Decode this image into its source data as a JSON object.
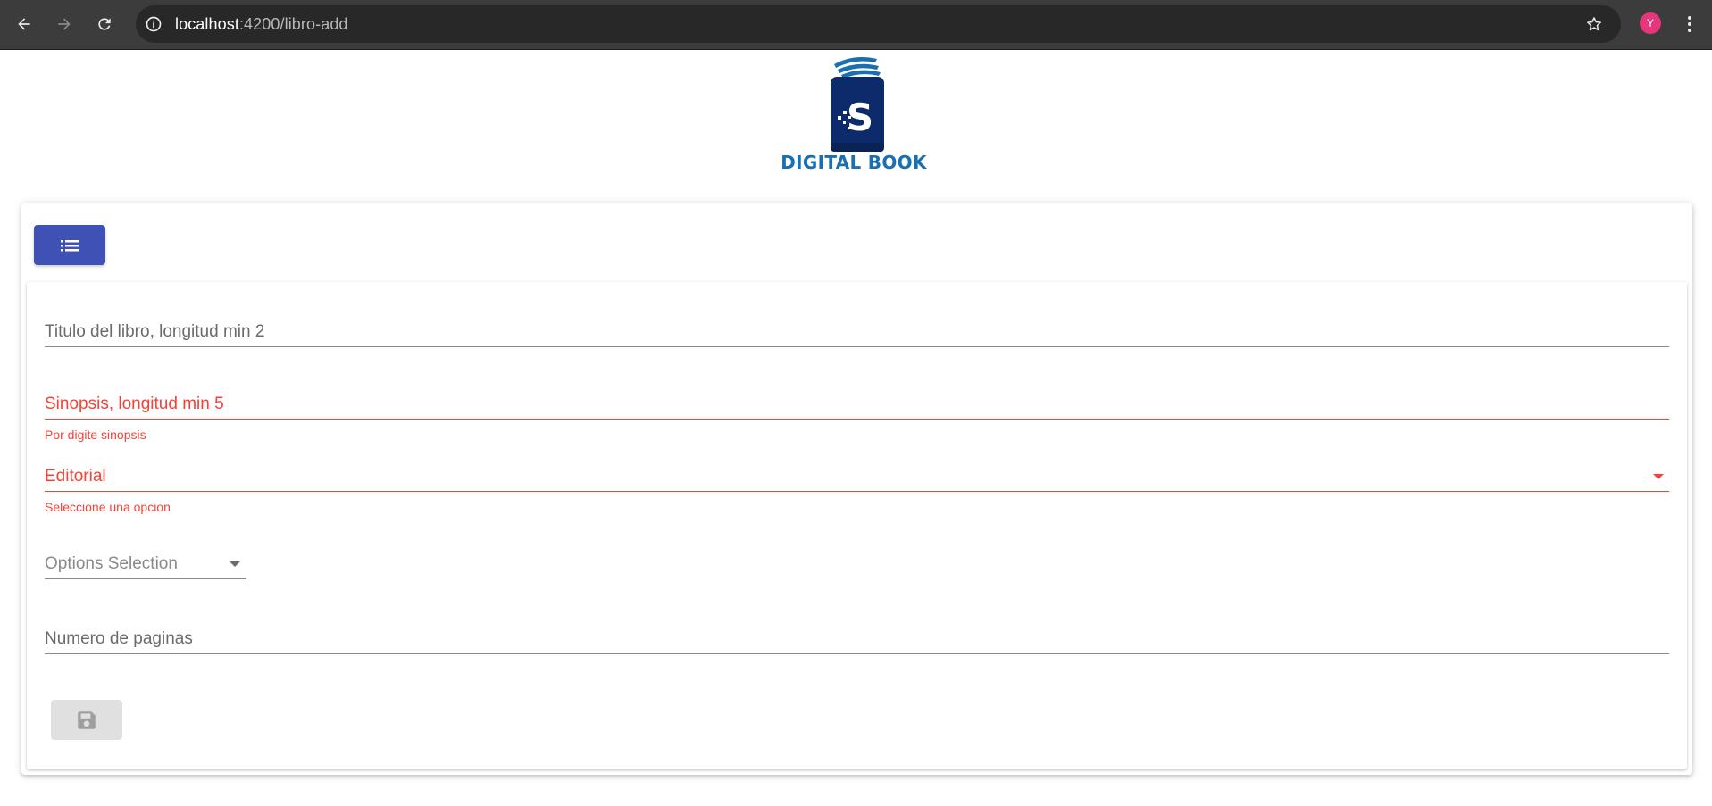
{
  "browser": {
    "url_host": "localhost",
    "url_rest": ":4200/libro-add",
    "profile_initial": "Y"
  },
  "brand": {
    "logo_text": "DIGITAL BOOK",
    "logo_letter": "S"
  },
  "form": {
    "titulo": {
      "label": "Titulo del libro, longitud min 2"
    },
    "sinopsis": {
      "label": "Sinopsis, longitud min 5",
      "error": "Por digite sinopsis"
    },
    "editorial": {
      "label": "Editorial",
      "error": "Seleccione una opcion"
    },
    "options": {
      "label": "Options Selection"
    },
    "paginas": {
      "label": "Numero de paginas"
    }
  },
  "icons": {
    "list_button": "format-list-icon",
    "save_button": "floppy-disk-icon"
  },
  "colors": {
    "primary": "#3f51b5",
    "error": "#f44336",
    "disabled": "#e0e0e0",
    "brand_blue": "#1a6fb3",
    "logo_navy": "#0d2b6b"
  }
}
